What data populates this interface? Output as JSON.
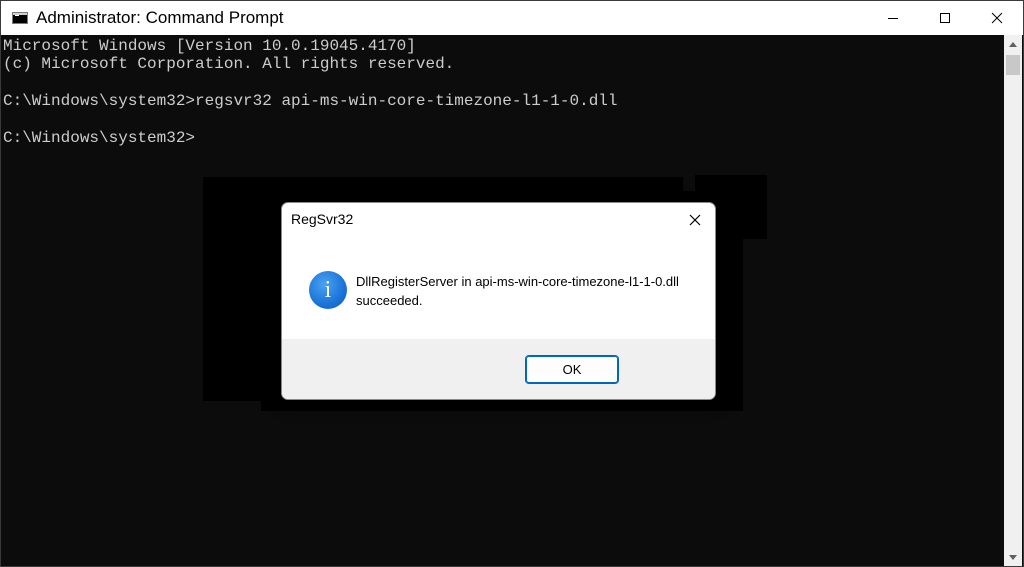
{
  "window": {
    "title": "Administrator: Command Prompt",
    "controls": [
      "minimize-icon",
      "maximize-icon",
      "close-icon"
    ]
  },
  "console": {
    "lines": [
      "Microsoft Windows [Version 10.0.19045.4170]",
      "(c) Microsoft Corporation. All rights reserved.",
      "",
      "C:\\Windows\\system32>regsvr32 api-ms-win-core-timezone-l1-1-0.dll",
      "",
      "C:\\Windows\\system32>"
    ]
  },
  "dialog": {
    "title": "RegSvr32",
    "icon": "info-icon",
    "message_line1": "DllRegisterServer in api-ms-win-core-timezone-l1-1-0.dll",
    "message_line2": "succeeded.",
    "ok_label": "OK"
  },
  "colors": {
    "console_bg": "#0c0c0c",
    "console_text": "#cccccc",
    "accent": "#0067c0"
  }
}
